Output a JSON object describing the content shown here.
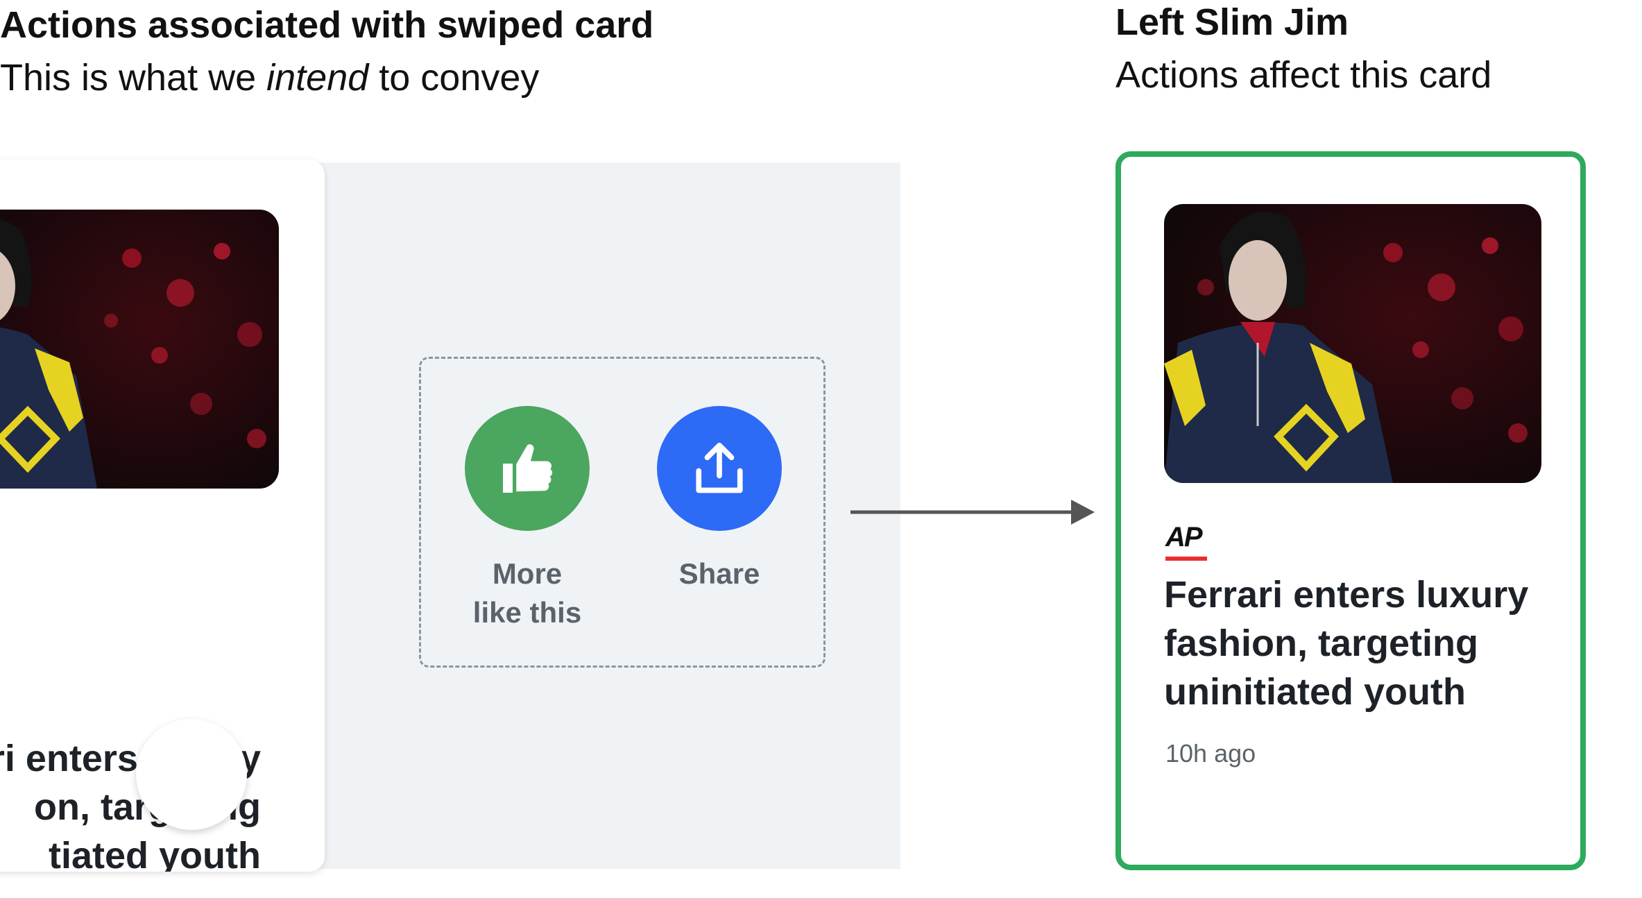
{
  "left_heading": {
    "title": "Actions associated with swiped card",
    "subtitle_before": "This is what we ",
    "subtitle_emphasis": "intend",
    "subtitle_after": " to convey"
  },
  "right_heading": {
    "title": "Left Slim Jim",
    "subtitle": "Actions affect this card"
  },
  "swiped_card": {
    "headline": "ri enters luxury\non, targeting\ntiated youth",
    "image_icon": "fashion-photo"
  },
  "actions": [
    {
      "label": "More\nlike this",
      "icon": "thumbs-up-icon",
      "color": "#4ba65f"
    },
    {
      "label": "Share",
      "icon": "share-icon",
      "color": "#2d6af6"
    }
  ],
  "result_card": {
    "publisher": "AP",
    "headline": "Ferrari enters luxury\nfashion, targeting\nuninitiated youth",
    "timestamp": "10h ago",
    "border_color": "#2eaa5c",
    "image_icon": "fashion-photo"
  }
}
